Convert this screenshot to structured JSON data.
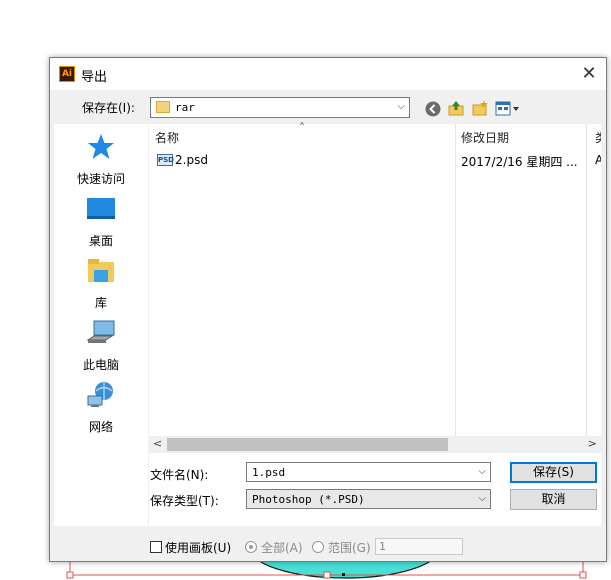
{
  "dialog": {
    "app_icon_text": "Ai",
    "title": "导出",
    "close_glyph": "✕"
  },
  "save_in": {
    "label": "保存在(I):",
    "value": "rar",
    "arrow": "⌵"
  },
  "toolbar_icons": [
    "back-icon",
    "up-folder-icon",
    "new-folder-icon",
    "view-menu-icon"
  ],
  "places": [
    {
      "label": "快速访问",
      "icon": "quick-access-star-icon"
    },
    {
      "label": "桌面",
      "icon": "desktop-icon"
    },
    {
      "label": "库",
      "icon": "libraries-icon"
    },
    {
      "label": "此电脑",
      "icon": "computer-icon"
    },
    {
      "label": "网络",
      "icon": "network-icon"
    }
  ],
  "file_list": {
    "col_name": "名称",
    "col_date": "修改日期",
    "col_type_clipped": "类",
    "sort_glyph": "˄",
    "files": [
      {
        "icon_text": "PSD",
        "name": "2.psd",
        "date": "2017/2/16 星期四 ...",
        "type_clipped": "Ad"
      }
    ],
    "scroll_left": "<",
    "scroll_right": ">"
  },
  "filename": {
    "label": "文件名(N):",
    "value": "1.psd"
  },
  "filetype": {
    "label": "保存类型(T):",
    "value": "Photoshop (*.PSD)"
  },
  "buttons": {
    "save": "保存(S)",
    "cancel": "取消"
  },
  "options": {
    "use_artboards": "使用画板(U)",
    "all": "全部(A)",
    "range": "范围(G)",
    "range_value": "1"
  },
  "colors": {
    "accent": "#0078d7",
    "selection_red": "#d9534f",
    "shape_teal": "#3fd6d0"
  }
}
